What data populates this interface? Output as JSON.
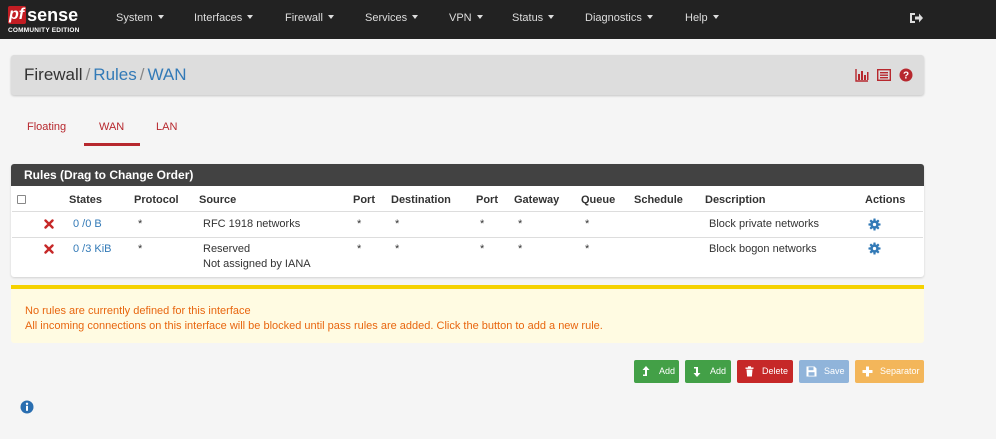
{
  "brand": {
    "logo_pf": "pf",
    "logo_sense": "sense",
    "logo_sub": "COMMUNITY EDITION"
  },
  "nav": {
    "items": [
      {
        "label": "System"
      },
      {
        "label": "Interfaces"
      },
      {
        "label": "Firewall"
      },
      {
        "label": "Services"
      },
      {
        "label": "VPN"
      },
      {
        "label": "Status"
      },
      {
        "label": "Diagnostics"
      },
      {
        "label": "Help"
      }
    ],
    "logout_icon": "sign-out-icon"
  },
  "breadcrumb": {
    "items": [
      {
        "label": "Firewall"
      },
      {
        "label": "Rules"
      },
      {
        "label": "WAN"
      }
    ],
    "separator": "/",
    "icons": [
      "bar-chart-icon",
      "log-list-icon",
      "help-icon"
    ]
  },
  "tabs": [
    {
      "label": "Floating",
      "active": false
    },
    {
      "label": "WAN",
      "active": true
    },
    {
      "label": "LAN",
      "active": false
    }
  ],
  "rules_panel": {
    "title": "Rules (Drag to Change Order)",
    "columns": [
      "States",
      "Protocol",
      "Source",
      "Port",
      "Destination",
      "Port",
      "Gateway",
      "Queue",
      "Schedule",
      "Description",
      "Actions"
    ],
    "rows": [
      {
        "status_icon": "x-icon",
        "states": "0 /0 B",
        "protocol": "*",
        "source": "RFC 1918 networks",
        "source_line2": "",
        "src_port": "*",
        "destination": "*",
        "dst_port": "*",
        "gateway": "*",
        "queue": "*",
        "schedule": "",
        "description": "Block private networks"
      },
      {
        "status_icon": "x-icon",
        "states": "0 /3 KiB",
        "protocol": "*",
        "source": "Reserved",
        "source_line2": "Not assigned by IANA",
        "src_port": "*",
        "destination": "*",
        "dst_port": "*",
        "gateway": "*",
        "queue": "*",
        "schedule": "",
        "description": "Block bogon networks"
      }
    ]
  },
  "warning": {
    "line1": "No rules are currently defined for this interface",
    "line2": "All incoming connections on this interface will be blocked until pass rules are added. Click the button to add a new rule."
  },
  "buttons": {
    "add_top": "Add",
    "add_bottom": "Add",
    "delete": "Delete",
    "save": "Save",
    "separator": "Separator"
  },
  "colors": {
    "navbar": "#222222",
    "accent_red": "#b7282e",
    "link_blue": "#337ab7",
    "warning_text": "#e8660f",
    "warning_bg": "#fffbe2",
    "btn_green": "#43a047",
    "btn_red": "#c62828",
    "btn_blue": "#90b4da",
    "btn_orange": "#f3b65a"
  }
}
